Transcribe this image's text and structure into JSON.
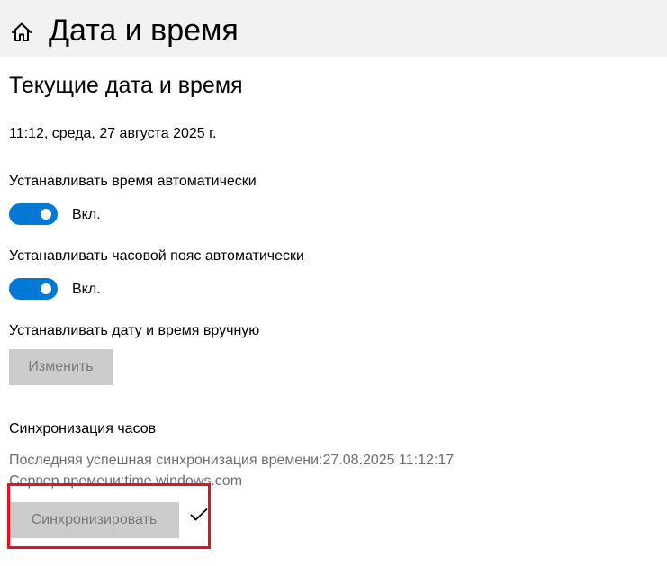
{
  "header": {
    "title": "Дата и время",
    "home_icon": "home-icon"
  },
  "current": {
    "section_title": "Текущие дата и время",
    "datetime": "11:12, среда, 27 августа 2025 г."
  },
  "auto_time": {
    "label": "Устанавливать время автоматически",
    "state": "Вкл.",
    "on": true
  },
  "auto_timezone": {
    "label": "Устанавливать часовой пояс автоматически",
    "state": "Вкл.",
    "on": true
  },
  "manual": {
    "label": "Устанавливать дату и время вручную",
    "button": "Изменить"
  },
  "sync": {
    "title": "Синхронизация часов",
    "last_sync": "Последняя успешная синхронизация времени:27.08.2025 11:12:17",
    "server": "Сервер времени:time.windows.com",
    "button": "Синхронизировать",
    "status_icon": "checkmark-icon"
  },
  "colors": {
    "accent": "#0078d4",
    "highlight": "#e81123",
    "header_bg": "#f2f2f2",
    "disabled_button": "#cccccc"
  }
}
